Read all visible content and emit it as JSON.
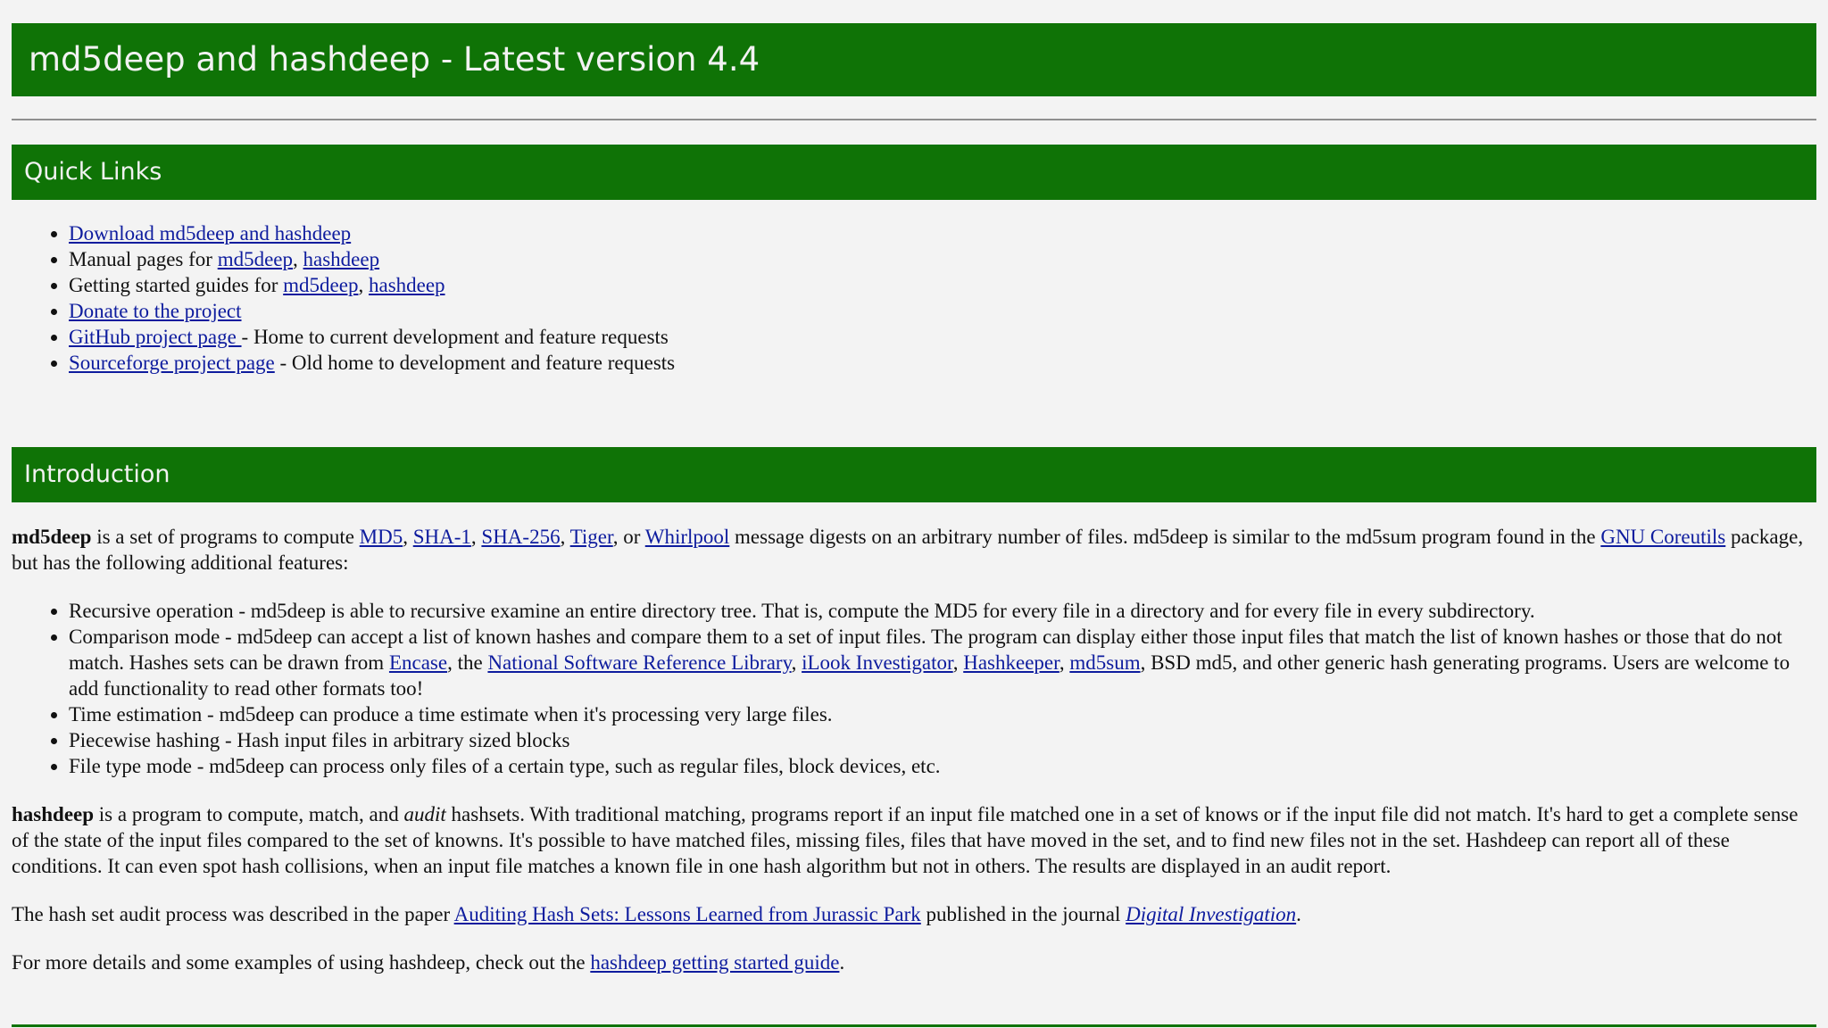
{
  "header": {
    "title": "md5deep and hashdeep - Latest version 4.4"
  },
  "quick_links": {
    "heading": "Quick Links",
    "download": "Download md5deep and hashdeep",
    "manual_prefix": "Manual pages for ",
    "manual_md5deep": "md5deep",
    "manual_hashdeep": "hashdeep",
    "guides_prefix": "Getting started guides for ",
    "guides_md5deep": "md5deep",
    "guides_hashdeep": "hashdeep",
    "donate": "Donate to the project",
    "github": "GitHub project page ",
    "github_suffix": "- Home to current development and feature requests",
    "sourceforge": "Sourceforge project page",
    "sourceforge_suffix": " - Old home to development and feature requests"
  },
  "intro": {
    "heading": "Introduction",
    "p1_bold": "md5deep",
    "p1_a": " is a set of programs to compute ",
    "link_md5": "MD5",
    "link_sha1": "SHA-1",
    "link_sha256": "SHA-256",
    "link_tiger": "Tiger",
    "p1_or": ", or ",
    "link_whirlpool": "Whirlpool",
    "p1_b": " message digests on an arbitrary number of files. md5deep is similar to the md5sum program found in the ",
    "link_coreutils": "GNU Coreutils",
    "p1_c": " package, but has the following additional features:",
    "feature_recursive": "Recursive operation - md5deep is able to recursive examine an entire directory tree. That is, compute the MD5 for every file in a directory and for every file in every subdirectory.",
    "feature_compare_a": "Comparison mode - md5deep can accept a list of known hashes and compare them to a set of input files. The program can display either those input files that match the list of known hashes or those that do not match. Hashes sets can be drawn from ",
    "link_encase": "Encase",
    "feature_compare_the": ", the ",
    "link_nsrl": "National Software Reference Library",
    "link_ilook": "iLook Investigator",
    "link_hashkeeper": "Hashkeeper",
    "link_md5sum": "md5sum",
    "feature_compare_b": ", BSD md5, and other generic hash generating programs. Users are welcome to add functionality to read other formats too!",
    "feature_time": "Time estimation - md5deep can produce a time estimate when it's processing very large files.",
    "feature_piecewise": "Piecewise hashing - Hash input files in arbitrary sized blocks",
    "feature_filetype": "File type mode - md5deep can process only files of a certain type, such as regular files, block devices, etc.",
    "p2_bold": "hashdeep",
    "p2_a": " is a program to compute, match, and ",
    "p2_italic": "audit",
    "p2_b": " hashsets. With traditional matching, programs report if an input file matched one in a set of knows or if the input file did not match. It's hard to get a complete sense of the state of the input files compared to the set of knowns. It's possible to have matched files, missing files, files that have moved in the set, and to find new files not in the set. Hashdeep can report all of these conditions. It can even spot hash collisions, when an input file matches a known file in one hash algorithm but not in others. The results are displayed in an audit report.",
    "p3_a": "The hash set audit process was described in the paper ",
    "link_paper": "Auditing Hash Sets: Lessons Learned from Jurassic Park",
    "p3_b": " published in the journal ",
    "link_journal": "Digital Investigation",
    "p3_c": ".",
    "p4_a": "For more details and some examples of using hashdeep, check out the ",
    "link_guide": "hashdeep getting started guide",
    "p4_b": "."
  },
  "colors": {
    "bar": "#0f7306",
    "background": "#f3f3f3",
    "link": "#0e1c9e"
  }
}
